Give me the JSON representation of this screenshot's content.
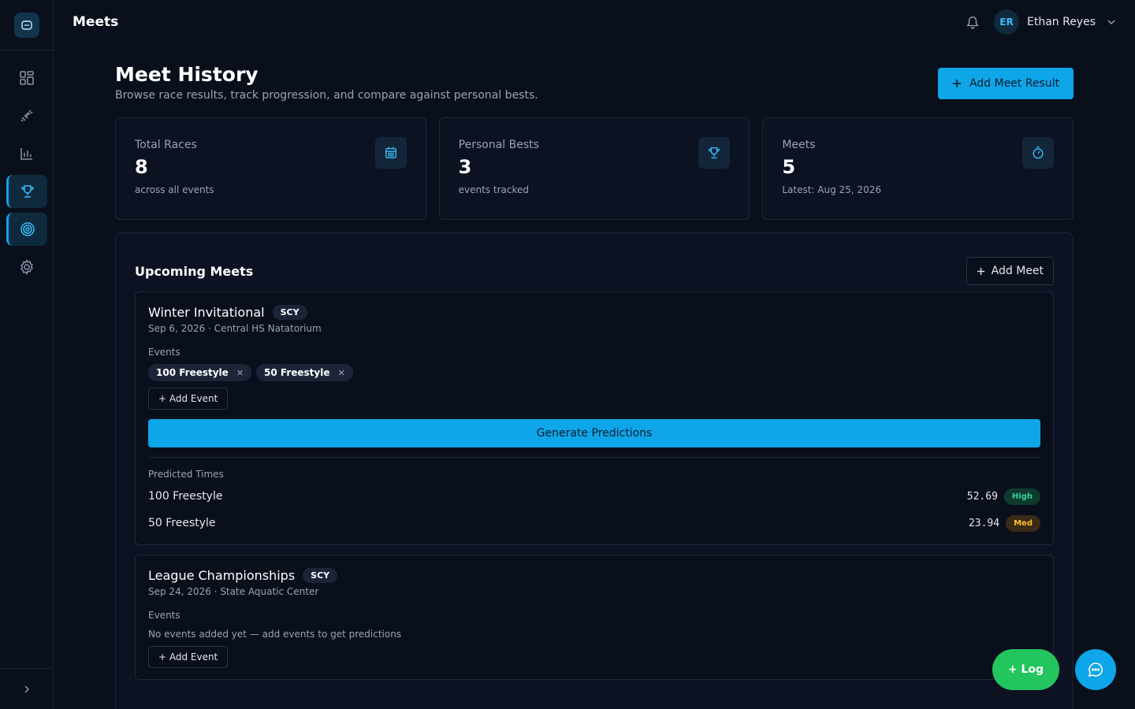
{
  "app": {
    "page_title": "Meets"
  },
  "user": {
    "initials": "ER",
    "name": "Ethan Reyes"
  },
  "header": {
    "title": "Meet History",
    "subtitle": "Browse race results, track progression, and compare against personal bests.",
    "add_result_label": "Add Meet Result"
  },
  "stats": [
    {
      "label": "Total Races",
      "value": "8",
      "note": "across all events",
      "icon": "calendar-icon"
    },
    {
      "label": "Personal Bests",
      "value": "3",
      "note": "events tracked",
      "icon": "trophy-icon"
    },
    {
      "label": "Meets",
      "value": "5",
      "note": "Latest: Aug 25, 2026",
      "icon": "stopwatch-icon"
    }
  ],
  "upcoming": {
    "title": "Upcoming Meets",
    "add_meet_label": "Add Meet",
    "meets": [
      {
        "name": "Winter Invitational",
        "course": "SCY",
        "meta": "Sep 6, 2026 · Central HS Natatorium",
        "events_label": "Events",
        "events": [
          "100 Freestyle",
          "50 Freestyle"
        ],
        "add_event_label": "+ Add Event",
        "generate_label": "Generate Predictions",
        "predicted_label": "Predicted Times",
        "predictions": [
          {
            "event": "100 Freestyle",
            "time": "52.69",
            "confidence": "High"
          },
          {
            "event": "50 Freestyle",
            "time": "23.94",
            "confidence": "Med"
          }
        ]
      },
      {
        "name": "League Championships",
        "course": "SCY",
        "meta": "Sep 24, 2026 · State Aquatic Center",
        "events_label": "Events",
        "empty_note": "No events added yet — add events to get predictions",
        "add_event_label": "+ Add Event"
      }
    ]
  },
  "fab": {
    "log_label": "+ Log"
  },
  "colors": {
    "accent": "#0ea5e9",
    "success": "#22c55e",
    "background": "#0a0f1c"
  }
}
